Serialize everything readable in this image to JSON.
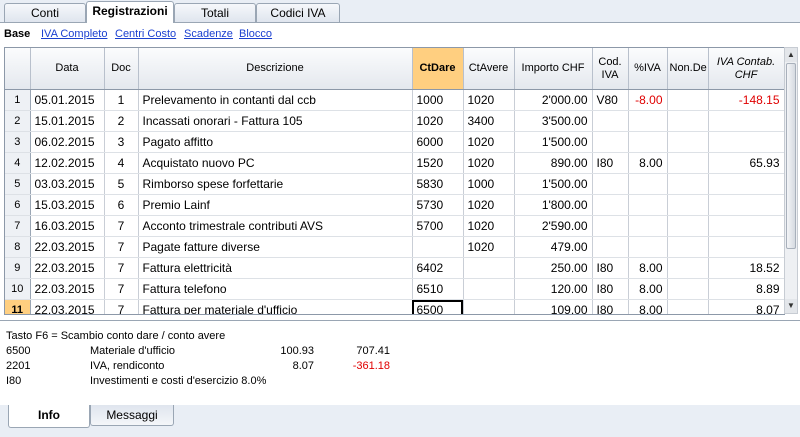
{
  "tabs": [
    {
      "label": "Conti"
    },
    {
      "label": "Registrazioni"
    },
    {
      "label": "Totali"
    },
    {
      "label": "Codici IVA"
    }
  ],
  "subnav": [
    {
      "label": "Base"
    },
    {
      "label": "IVA Completo"
    },
    {
      "label": "Centri Costo"
    },
    {
      "label": "Scadenze"
    },
    {
      "label": "Blocco"
    }
  ],
  "columns": {
    "data": "Data",
    "doc": "Doc",
    "descrizione": "Descrizione",
    "ctdare": "CtDare",
    "ctavere": "CtAvere",
    "importo": "Importo CHF",
    "codiva": "Cod. IVA",
    "piva": "%IVA",
    "nonded": "Non.De",
    "ivacontab": "IVA Contab. CHF"
  },
  "rows": [
    {
      "n": "1",
      "data": "05.01.2015",
      "doc": "1",
      "desc": "Prelevamento in contanti dal ccb",
      "dare": "1000",
      "avere": "1020",
      "importo": "2'000.00",
      "codiva": "V80",
      "piva": "-8.00",
      "nonded": "",
      "ivacontab": "-148.15"
    },
    {
      "n": "2",
      "data": "15.01.2015",
      "doc": "2",
      "desc": "Incassati onorari - Fattura 105",
      "dare": "1020",
      "avere": "3400",
      "importo": "3'500.00",
      "codiva": "",
      "piva": "",
      "nonded": "",
      "ivacontab": ""
    },
    {
      "n": "3",
      "data": "06.02.2015",
      "doc": "3",
      "desc": "Pagato affitto",
      "dare": "6000",
      "avere": "1020",
      "importo": "1'500.00",
      "codiva": "",
      "piva": "",
      "nonded": "",
      "ivacontab": ""
    },
    {
      "n": "4",
      "data": "12.02.2015",
      "doc": "4",
      "desc": "Acquistato nuovo PC",
      "dare": "1520",
      "avere": "1020",
      "importo": "890.00",
      "codiva": "I80",
      "piva": "8.00",
      "nonded": "",
      "ivacontab": "65.93"
    },
    {
      "n": "5",
      "data": "03.03.2015",
      "doc": "5",
      "desc": "Rimborso spese forfettarie",
      "dare": "5830",
      "avere": "1000",
      "importo": "1'500.00",
      "codiva": "",
      "piva": "",
      "nonded": "",
      "ivacontab": ""
    },
    {
      "n": "6",
      "data": "15.03.2015",
      "doc": "6",
      "desc": "Premio Lainf",
      "dare": "5730",
      "avere": "1020",
      "importo": "1'800.00",
      "codiva": "",
      "piva": "",
      "nonded": "",
      "ivacontab": ""
    },
    {
      "n": "7",
      "data": "16.03.2015",
      "doc": "7",
      "desc": "Acconto trimestrale contributi AVS",
      "dare": "5700",
      "avere": "1020",
      "importo": "2'590.00",
      "codiva": "",
      "piva": "",
      "nonded": "",
      "ivacontab": ""
    },
    {
      "n": "8",
      "data": "22.03.2015",
      "doc": "7",
      "desc": "Pagate fatture diverse",
      "dare": "",
      "avere": "1020",
      "importo": "479.00",
      "codiva": "",
      "piva": "",
      "nonded": "",
      "ivacontab": ""
    },
    {
      "n": "9",
      "data": "22.03.2015",
      "doc": "7",
      "desc": "Fattura elettricità",
      "dare": "6402",
      "avere": "",
      "importo": "250.00",
      "codiva": "I80",
      "piva": "8.00",
      "nonded": "",
      "ivacontab": "18.52"
    },
    {
      "n": "10",
      "data": "22.03.2015",
      "doc": "7",
      "desc": "Fattura telefono",
      "dare": "6510",
      "avere": "",
      "importo": "120.00",
      "codiva": "I80",
      "piva": "8.00",
      "nonded": "",
      "ivacontab": "8.89"
    },
    {
      "n": "11",
      "data": "22.03.2015",
      "doc": "7",
      "desc": "Fattura per materiale d'ufficio",
      "dare": "6500",
      "avere": "",
      "importo": "109.00",
      "codiva": "I80",
      "piva": "8.00",
      "nonded": "",
      "ivacontab": "8.07"
    }
  ],
  "info": {
    "hint": "Tasto F6 = Scambio conto dare / conto avere",
    "lines": [
      {
        "code": "6500",
        "name": "Materiale d'ufficio",
        "v1": "100.93",
        "v2": "707.41"
      },
      {
        "code": "2201",
        "name": "IVA, rendiconto",
        "v1": "8.07",
        "v2": "-361.18"
      },
      {
        "code": "I80",
        "name": "Investimenti e costi d'esercizio 8.0%",
        "v1": "",
        "v2": ""
      }
    ]
  },
  "bottom_tabs": [
    {
      "label": "Info"
    },
    {
      "label": "Messaggi"
    }
  ],
  "colors": {
    "accent": "#ffcf80",
    "negative": "#e00000",
    "link": "#1a3fd0"
  }
}
